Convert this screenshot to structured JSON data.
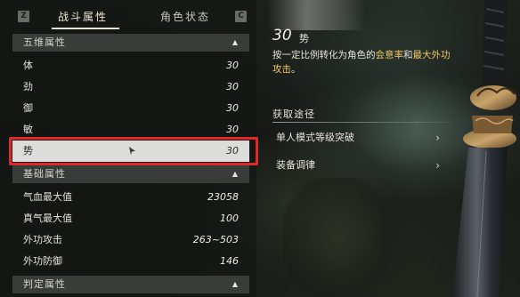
{
  "tabs": {
    "left_key": "Z",
    "right_key": "C",
    "items": [
      {
        "label": "战斗属性"
      },
      {
        "label": "角色状态"
      }
    ]
  },
  "sections": {
    "five": {
      "title": "五维属性",
      "rows": [
        {
          "label": "体",
          "value": "30"
        },
        {
          "label": "劲",
          "value": "30"
        },
        {
          "label": "御",
          "value": "30"
        },
        {
          "label": "敏",
          "value": "30"
        },
        {
          "label": "势",
          "value": "30"
        }
      ]
    },
    "basic": {
      "title": "基础属性",
      "rows": [
        {
          "label": "气血最大值",
          "value": "23058"
        },
        {
          "label": "真气最大值",
          "value": "100"
        },
        {
          "label": "外功攻击",
          "value": "263~503"
        },
        {
          "label": "外功防御",
          "value": "146"
        }
      ]
    },
    "judge": {
      "title": "判定属性"
    }
  },
  "detail": {
    "value": "30",
    "name": "势",
    "desc_pre": "按一定比例转化为角色的",
    "desc_hl1": "会意率",
    "desc_mid": "和",
    "desc_hl2": "最大外功攻击",
    "desc_post": "。"
  },
  "source": {
    "title": "获取途径",
    "items": [
      {
        "label": "单人模式等级突破"
      },
      {
        "label": "装备调律"
      }
    ]
  },
  "colors": {
    "highlight_box": "#e0282a",
    "keyword": "#f2c86a",
    "selected_row": "#dcdcda"
  }
}
